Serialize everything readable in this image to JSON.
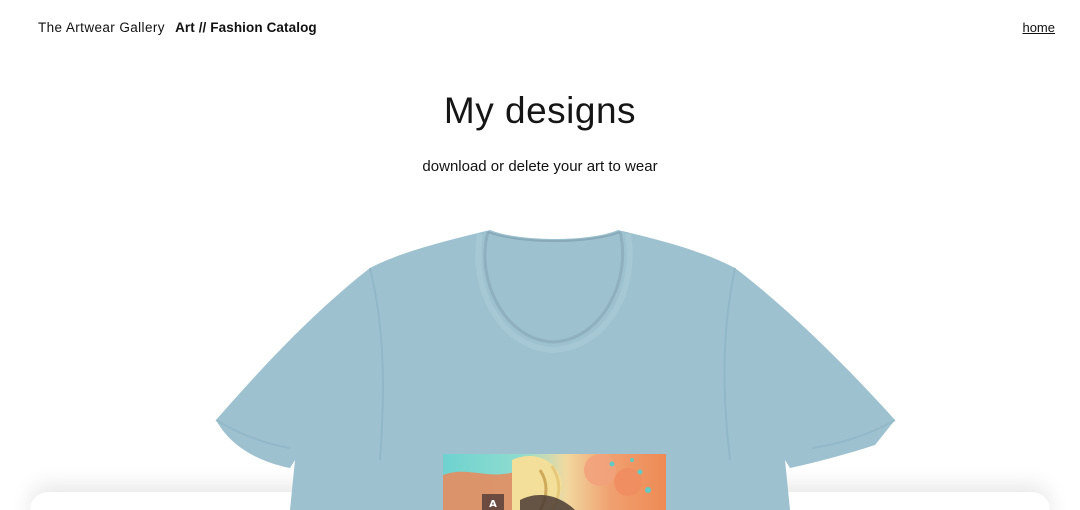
{
  "header": {
    "brand_name": "The Artwear Gallery",
    "brand_sub": "Art // Fashion Catalog",
    "home_link": "home"
  },
  "hero": {
    "title": "My designs",
    "subtitle": "download or delete your art to wear"
  },
  "colors": {
    "shirt": "#9dc1cf",
    "shirt_shade": "#8fb5c4",
    "background": "#ffffff",
    "text": "#111111"
  },
  "design": {
    "badge_letter": "A"
  }
}
